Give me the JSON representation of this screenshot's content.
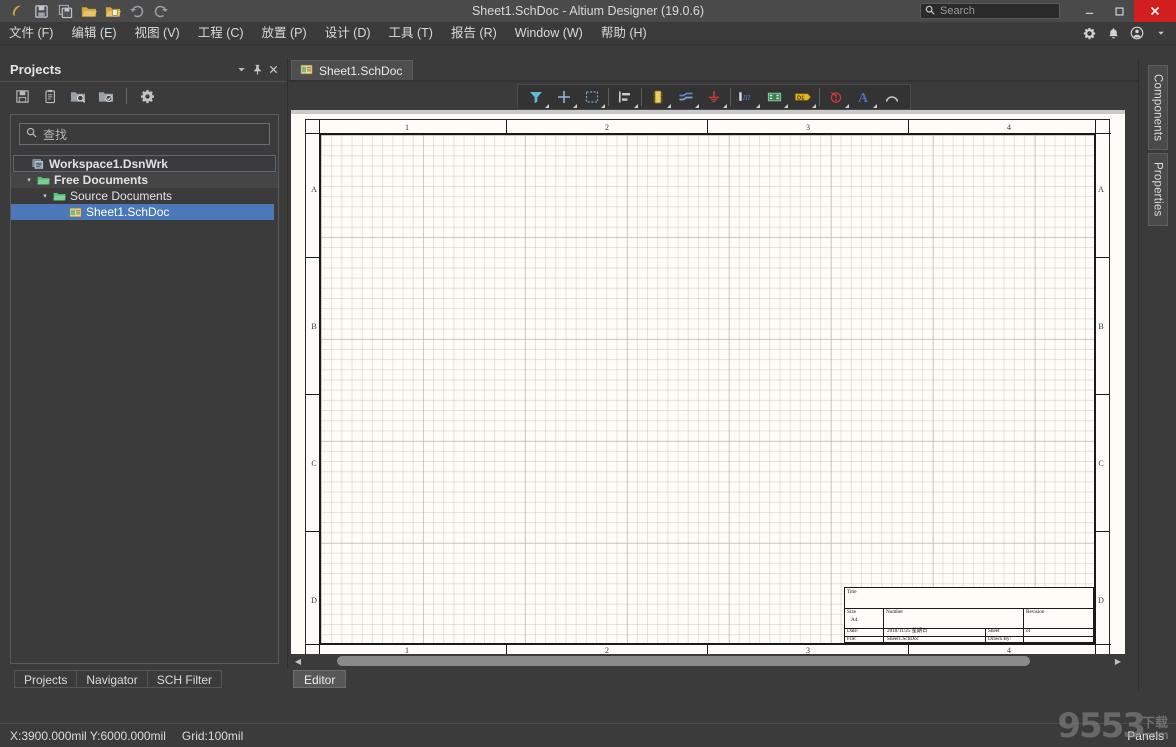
{
  "window": {
    "title": "Sheet1.SchDoc - Altium Designer (19.0.6)",
    "quick_access": [
      {
        "name": "altium-logo-icon",
        "label": "Altium"
      },
      {
        "name": "save-icon",
        "label": "Save"
      },
      {
        "name": "save-all-icon",
        "label": "Save All"
      },
      {
        "name": "open-icon",
        "label": "Open"
      },
      {
        "name": "open-project-icon",
        "label": "Open Project"
      },
      {
        "name": "undo-icon",
        "label": "Undo"
      },
      {
        "name": "redo-icon",
        "label": "Redo"
      }
    ],
    "search": {
      "placeholder": "Search",
      "value": "",
      "icon": "search-icon"
    },
    "controls": {
      "minimize": "–",
      "maximize": "☐",
      "close": "✕",
      "close_color": "#d21e1e"
    }
  },
  "menubar": {
    "items": [
      {
        "label": "文件 (F)"
      },
      {
        "label": "编辑 (E)"
      },
      {
        "label": "视图 (V)"
      },
      {
        "label": "工程 (C)"
      },
      {
        "label": "放置 (P)"
      },
      {
        "label": "设计 (D)"
      },
      {
        "label": "工具 (T)"
      },
      {
        "label": "报告 (R)"
      },
      {
        "label": "Window (W)"
      },
      {
        "label": "帮助 (H)"
      }
    ],
    "right_icons": [
      {
        "name": "gear-icon"
      },
      {
        "name": "bell-icon"
      },
      {
        "name": "user-account-icon"
      },
      {
        "name": "chevron-down-icon"
      }
    ]
  },
  "projects_panel": {
    "title": "Projects",
    "header_buttons": [
      {
        "name": "panel-dropdown-button",
        "glyph": "▼"
      },
      {
        "name": "panel-pin-button",
        "glyph": "pin"
      },
      {
        "name": "panel-close-button",
        "glyph": "✕"
      }
    ],
    "toolbar": [
      {
        "name": "save-project-icon"
      },
      {
        "name": "compile-project-icon"
      },
      {
        "name": "open-project-search-icon"
      },
      {
        "name": "project-options-folder-icon"
      },
      {
        "name": "project-settings-gear-icon"
      }
    ],
    "find": {
      "placeholder": "查找",
      "value": "查找",
      "icon": "search-icon"
    },
    "tree": [
      {
        "label": "Workspace1.DsnWrk",
        "icon": "workspace-icon",
        "depth": 0,
        "state": "framed",
        "bold": true,
        "arrow": ""
      },
      {
        "label": "Free Documents",
        "icon": "folder-icon",
        "depth": 1,
        "state": "hover",
        "bold": true,
        "arrow": "▾"
      },
      {
        "label": "Source Documents",
        "icon": "folder-icon",
        "depth": 2,
        "state": "normal",
        "bold": false,
        "arrow": "▾"
      },
      {
        "label": "Sheet1.SchDoc",
        "icon": "schdoc-icon",
        "depth": 3,
        "state": "selected",
        "bold": false,
        "arrow": ""
      }
    ],
    "bottom_tabs": [
      {
        "label": "Projects",
        "active": false
      },
      {
        "label": "Navigator",
        "active": false
      },
      {
        "label": "SCH Filter",
        "active": false
      }
    ]
  },
  "editor": {
    "document_tabs": [
      {
        "label": "Sheet1.SchDoc",
        "icon": "schdoc-icon",
        "active": true
      }
    ],
    "toolbar": [
      {
        "name": "filter-icon",
        "color": "#5fb8d6",
        "has_caret": true
      },
      {
        "name": "crosshair-place-icon",
        "color": "#7fa9d9",
        "has_caret": true
      },
      {
        "name": "selection-box-icon",
        "color": "#6f8fc0",
        "has_caret": true
      },
      {
        "name": "align-left-icon",
        "color": "#cfcfcf",
        "has_caret": true
      },
      {
        "name": "place-part-icon",
        "color": "#e3c23c",
        "has_caret": true
      },
      {
        "name": "place-wire-icon",
        "color": "#4e7fb8",
        "has_caret": true
      },
      {
        "name": "place-gnd-power-port-icon",
        "color": "#cc3333",
        "has_caret": true
      },
      {
        "name": "place-net-label-icon",
        "color": "#3d6fb5",
        "has_caret": true
      },
      {
        "name": "place-sheet-symbol-icon",
        "color": "#4aa54a",
        "has_caret": true
      },
      {
        "name": "place-port-icon",
        "color": "#e0b020",
        "has_caret": true
      },
      {
        "name": "place-no-erc-icon",
        "color": "#d13a3a",
        "has_caret": true
      },
      {
        "name": "place-text-icon",
        "color": "#4a6fbf",
        "has_caret": true
      },
      {
        "name": "place-arc-icon",
        "color": "#c8c8c8",
        "has_caret": false
      }
    ],
    "canvas": {
      "zone_columns": [
        "1",
        "2",
        "3",
        "4"
      ],
      "zone_rows": [
        "A",
        "B",
        "C",
        "D"
      ],
      "paper_color": "#fdfcf7",
      "border_color": "#1a1a1a"
    },
    "title_block": {
      "title_label": "Title",
      "title_value": "",
      "size_label": "Size",
      "size_value": "A4",
      "number_label": "Number",
      "number_value": "",
      "revision_label": "Revision",
      "revision_value": "",
      "date_label": "Date:",
      "date_value": "2018/11/25 星期日",
      "sheet_label": "Sheet",
      "sheet_of": "of",
      "file_label": "File:",
      "file_value": "Sheet1.SchDoc",
      "drawn_by_label": "Drawn By:"
    },
    "bottom_tabs": [
      {
        "label": "Editor",
        "active": true
      }
    ],
    "hscrollbar": {
      "left_arrow": "◀",
      "right_arrow": "▶"
    }
  },
  "right_dock": {
    "tabs": [
      {
        "label": "Components"
      },
      {
        "label": "Properties"
      }
    ]
  },
  "statusbar": {
    "coordinates": "X:3900.000mil Y:6000.000mil",
    "grid": "Grid:100mil",
    "panels_button": "Panels"
  },
  "watermark": {
    "number": "9553",
    "cn_top": "下载",
    "cn_bottom": ".com"
  }
}
